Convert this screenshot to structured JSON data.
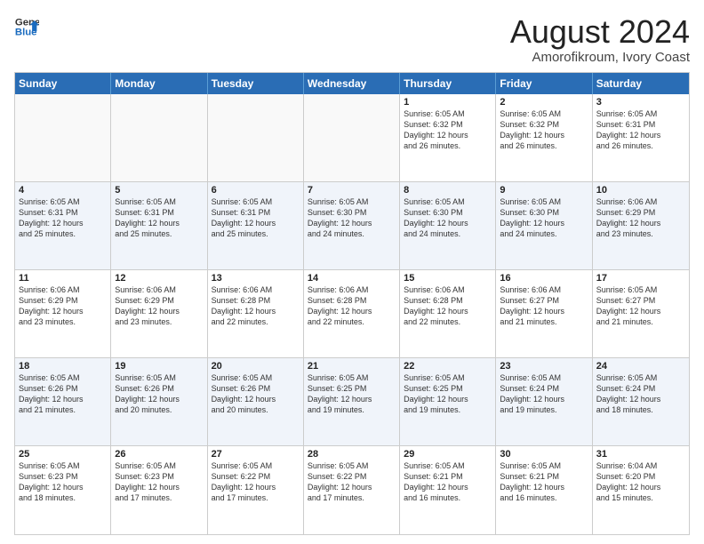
{
  "logo": {
    "line1": "General",
    "line2": "Blue"
  },
  "title": "August 2024",
  "subtitle": "Amorofikroum, Ivory Coast",
  "weekdays": [
    "Sunday",
    "Monday",
    "Tuesday",
    "Wednesday",
    "Thursday",
    "Friday",
    "Saturday"
  ],
  "weeks": [
    [
      {
        "day": "",
        "lines": []
      },
      {
        "day": "",
        "lines": []
      },
      {
        "day": "",
        "lines": []
      },
      {
        "day": "",
        "lines": []
      },
      {
        "day": "1",
        "lines": [
          "Sunrise: 6:05 AM",
          "Sunset: 6:32 PM",
          "Daylight: 12 hours",
          "and 26 minutes."
        ]
      },
      {
        "day": "2",
        "lines": [
          "Sunrise: 6:05 AM",
          "Sunset: 6:32 PM",
          "Daylight: 12 hours",
          "and 26 minutes."
        ]
      },
      {
        "day": "3",
        "lines": [
          "Sunrise: 6:05 AM",
          "Sunset: 6:31 PM",
          "Daylight: 12 hours",
          "and 26 minutes."
        ]
      }
    ],
    [
      {
        "day": "4",
        "lines": [
          "Sunrise: 6:05 AM",
          "Sunset: 6:31 PM",
          "Daylight: 12 hours",
          "and 25 minutes."
        ]
      },
      {
        "day": "5",
        "lines": [
          "Sunrise: 6:05 AM",
          "Sunset: 6:31 PM",
          "Daylight: 12 hours",
          "and 25 minutes."
        ]
      },
      {
        "day": "6",
        "lines": [
          "Sunrise: 6:05 AM",
          "Sunset: 6:31 PM",
          "Daylight: 12 hours",
          "and 25 minutes."
        ]
      },
      {
        "day": "7",
        "lines": [
          "Sunrise: 6:05 AM",
          "Sunset: 6:30 PM",
          "Daylight: 12 hours",
          "and 24 minutes."
        ]
      },
      {
        "day": "8",
        "lines": [
          "Sunrise: 6:05 AM",
          "Sunset: 6:30 PM",
          "Daylight: 12 hours",
          "and 24 minutes."
        ]
      },
      {
        "day": "9",
        "lines": [
          "Sunrise: 6:05 AM",
          "Sunset: 6:30 PM",
          "Daylight: 12 hours",
          "and 24 minutes."
        ]
      },
      {
        "day": "10",
        "lines": [
          "Sunrise: 6:06 AM",
          "Sunset: 6:29 PM",
          "Daylight: 12 hours",
          "and 23 minutes."
        ]
      }
    ],
    [
      {
        "day": "11",
        "lines": [
          "Sunrise: 6:06 AM",
          "Sunset: 6:29 PM",
          "Daylight: 12 hours",
          "and 23 minutes."
        ]
      },
      {
        "day": "12",
        "lines": [
          "Sunrise: 6:06 AM",
          "Sunset: 6:29 PM",
          "Daylight: 12 hours",
          "and 23 minutes."
        ]
      },
      {
        "day": "13",
        "lines": [
          "Sunrise: 6:06 AM",
          "Sunset: 6:28 PM",
          "Daylight: 12 hours",
          "and 22 minutes."
        ]
      },
      {
        "day": "14",
        "lines": [
          "Sunrise: 6:06 AM",
          "Sunset: 6:28 PM",
          "Daylight: 12 hours",
          "and 22 minutes."
        ]
      },
      {
        "day": "15",
        "lines": [
          "Sunrise: 6:06 AM",
          "Sunset: 6:28 PM",
          "Daylight: 12 hours",
          "and 22 minutes."
        ]
      },
      {
        "day": "16",
        "lines": [
          "Sunrise: 6:06 AM",
          "Sunset: 6:27 PM",
          "Daylight: 12 hours",
          "and 21 minutes."
        ]
      },
      {
        "day": "17",
        "lines": [
          "Sunrise: 6:05 AM",
          "Sunset: 6:27 PM",
          "Daylight: 12 hours",
          "and 21 minutes."
        ]
      }
    ],
    [
      {
        "day": "18",
        "lines": [
          "Sunrise: 6:05 AM",
          "Sunset: 6:26 PM",
          "Daylight: 12 hours",
          "and 21 minutes."
        ]
      },
      {
        "day": "19",
        "lines": [
          "Sunrise: 6:05 AM",
          "Sunset: 6:26 PM",
          "Daylight: 12 hours",
          "and 20 minutes."
        ]
      },
      {
        "day": "20",
        "lines": [
          "Sunrise: 6:05 AM",
          "Sunset: 6:26 PM",
          "Daylight: 12 hours",
          "and 20 minutes."
        ]
      },
      {
        "day": "21",
        "lines": [
          "Sunrise: 6:05 AM",
          "Sunset: 6:25 PM",
          "Daylight: 12 hours",
          "and 19 minutes."
        ]
      },
      {
        "day": "22",
        "lines": [
          "Sunrise: 6:05 AM",
          "Sunset: 6:25 PM",
          "Daylight: 12 hours",
          "and 19 minutes."
        ]
      },
      {
        "day": "23",
        "lines": [
          "Sunrise: 6:05 AM",
          "Sunset: 6:24 PM",
          "Daylight: 12 hours",
          "and 19 minutes."
        ]
      },
      {
        "day": "24",
        "lines": [
          "Sunrise: 6:05 AM",
          "Sunset: 6:24 PM",
          "Daylight: 12 hours",
          "and 18 minutes."
        ]
      }
    ],
    [
      {
        "day": "25",
        "lines": [
          "Sunrise: 6:05 AM",
          "Sunset: 6:23 PM",
          "Daylight: 12 hours",
          "and 18 minutes."
        ]
      },
      {
        "day": "26",
        "lines": [
          "Sunrise: 6:05 AM",
          "Sunset: 6:23 PM",
          "Daylight: 12 hours",
          "and 17 minutes."
        ]
      },
      {
        "day": "27",
        "lines": [
          "Sunrise: 6:05 AM",
          "Sunset: 6:22 PM",
          "Daylight: 12 hours",
          "and 17 minutes."
        ]
      },
      {
        "day": "28",
        "lines": [
          "Sunrise: 6:05 AM",
          "Sunset: 6:22 PM",
          "Daylight: 12 hours",
          "and 17 minutes."
        ]
      },
      {
        "day": "29",
        "lines": [
          "Sunrise: 6:05 AM",
          "Sunset: 6:21 PM",
          "Daylight: 12 hours",
          "and 16 minutes."
        ]
      },
      {
        "day": "30",
        "lines": [
          "Sunrise: 6:05 AM",
          "Sunset: 6:21 PM",
          "Daylight: 12 hours",
          "and 16 minutes."
        ]
      },
      {
        "day": "31",
        "lines": [
          "Sunrise: 6:04 AM",
          "Sunset: 6:20 PM",
          "Daylight: 12 hours",
          "and 15 minutes."
        ]
      }
    ]
  ],
  "alt_rows": [
    1,
    3
  ]
}
